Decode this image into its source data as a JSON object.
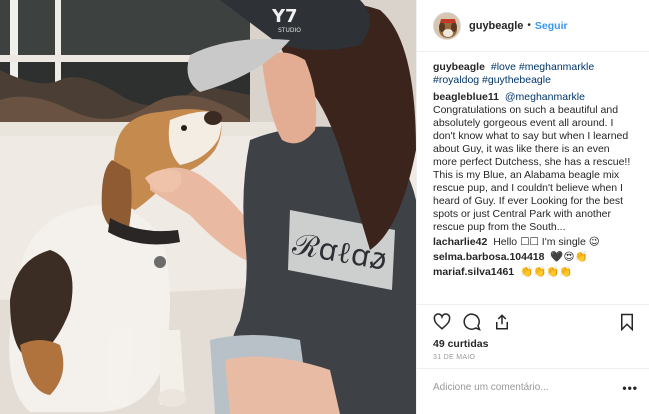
{
  "header": {
    "username": "guybeagle",
    "separator": "•",
    "follow_label": "Seguir"
  },
  "caption": {
    "username": "guybeagle",
    "tags": "#love #meghanmarkle #royaldog #guythebeagle"
  },
  "comments": [
    {
      "username": "beagleblue11",
      "mention": "@meghanmarkle",
      "text": "Congratulations on such a beautiful and absolutely gorgeous event all around. I don't know what to say but when I learned about Guy, it was like there is an even more perfect Dutchess, she has a rescue!! This is my Blue, an Alabama beagle mix rescue pup, and I couldn't believe when I heard of Guy. If ever Looking for the best spots or just Central Park with another rescue pup from the South..."
    },
    {
      "username": "lacharlie42",
      "text": "Hello ☐☐ I'm single 😉"
    },
    {
      "username": "selma.barbosa.104418",
      "text": "🖤😍👏"
    },
    {
      "username": "mariaf.silva1461",
      "text": "👏👏👏👏"
    }
  ],
  "actions": {
    "like_icon": "heart-icon",
    "comment_icon": "comment-icon",
    "share_icon": "share-icon",
    "save_icon": "bookmark-icon"
  },
  "likes_label": "49 curtidas",
  "date_label": "31 DE MAIO",
  "comment_input": {
    "placeholder": "Adicione um comentário..."
  },
  "more_label": "•••",
  "photo": {
    "cap_text": "Y7",
    "cap_subtext": "STUDIO",
    "shirt_text": "ℛꭤℓꭤꬿ"
  }
}
